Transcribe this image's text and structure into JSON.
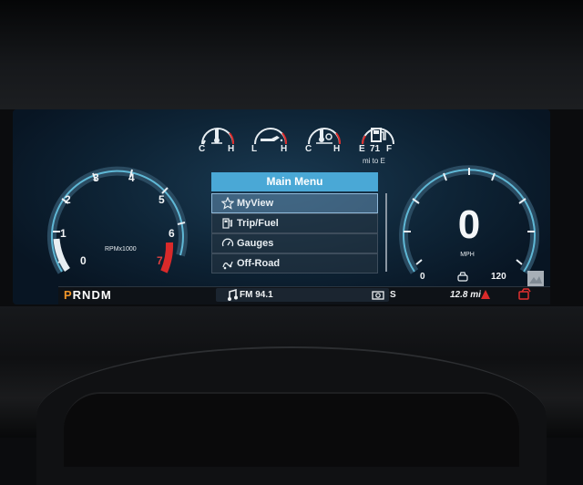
{
  "cluster": {
    "status_gauges": [
      {
        "name": "coolant-temp",
        "left": "C",
        "right": "H"
      },
      {
        "name": "oil-pressure",
        "left": "L",
        "right": "H"
      },
      {
        "name": "transmission-temp",
        "left": "C",
        "right": "H"
      },
      {
        "name": "fuel",
        "left": "E",
        "mid": "71",
        "right": "F",
        "sub": "mi to E"
      }
    ],
    "tachometer": {
      "ticks": [
        "0",
        "1",
        "2",
        "3",
        "4",
        "5",
        "6",
        "7"
      ],
      "unit": "RPMx1000"
    },
    "speedometer": {
      "value": "0",
      "unit": "MPH",
      "min": "0",
      "max": "120"
    },
    "menu": {
      "title": "Main Menu",
      "items": [
        {
          "label": "MyView",
          "icon": "star-icon",
          "selected": true
        },
        {
          "label": "Trip/Fuel",
          "icon": "fuel-pump-icon",
          "selected": false
        },
        {
          "label": "Gauges",
          "icon": "gauge-icon",
          "selected": false
        },
        {
          "label": "Off-Road",
          "icon": "off-road-icon",
          "selected": false
        }
      ]
    },
    "status_bar": {
      "gear_selected": "P",
      "gear_rest": "RNDM",
      "radio": "FM 94.1",
      "compass": "S",
      "range": "12.8 mi"
    },
    "colors": {
      "accent": "#4aa8d6",
      "gauge_ring": "#5fb8d6",
      "redline": "#d92a2a",
      "gear_active": "#f0962a",
      "warning": "#e03030"
    }
  }
}
